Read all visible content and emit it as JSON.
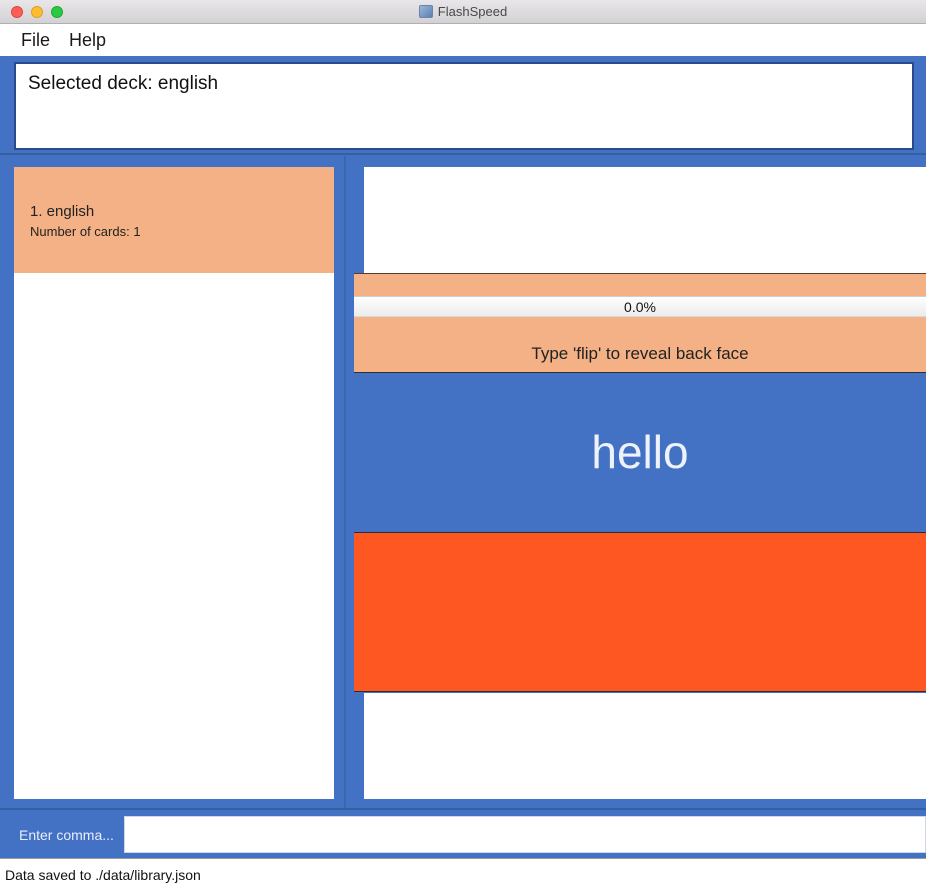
{
  "window": {
    "title": "FlashSpeed"
  },
  "menu": {
    "file": "File",
    "help": "Help"
  },
  "result": {
    "text": "Selected deck: english"
  },
  "decks": [
    {
      "name": "1.  english",
      "count": "Number of cards: 1"
    }
  ],
  "card": {
    "progress": "0.0%",
    "progress_fraction": 0.0,
    "hint": "Type 'flip' to reveal back face",
    "front": "hello",
    "back": ""
  },
  "command": {
    "placeholder_label": "Enter comma...",
    "value": ""
  },
  "status": {
    "text": "Data saved to ./data/library.json"
  },
  "colors": {
    "primary": "#4372c4",
    "card_highlight": "#f3b185",
    "back_face": "#fe5722"
  }
}
